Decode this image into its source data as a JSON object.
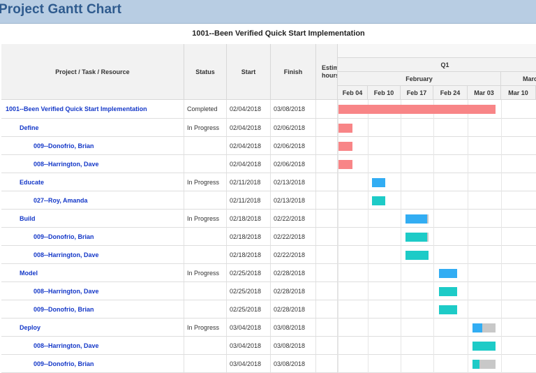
{
  "page_title": "Project Gantt Chart",
  "project_header": "1001--Been Verified Quick Start Implementation",
  "columns": {
    "task": "Project / Task / Resource",
    "status": "Status",
    "start": "Start",
    "finish": "Finish",
    "estimate": "Estimated hours"
  },
  "timeline": {
    "quarter": "Q1",
    "months": [
      "February",
      "March"
    ],
    "weeks": [
      "Feb 04",
      "Feb 10",
      "Feb 17",
      "Feb 24",
      "Mar 03",
      "Mar 10"
    ]
  },
  "colors": {
    "project": "#f88587",
    "task": "#32adf3",
    "resource": "#1dcbc7",
    "remaining": "#c8c8c8"
  },
  "rows": [
    {
      "name": "1001--Been Verified Quick Start Implementation",
      "level": 0,
      "status": "Completed",
      "start": "02/04/2018",
      "finish": "03/08/2018",
      "bar": {
        "start": "2018-02-04",
        "end": "2018-03-08",
        "kind": "project",
        "progress": 1
      }
    },
    {
      "name": "Define",
      "level": 1,
      "status": "In Progress",
      "start": "02/04/2018",
      "finish": "02/06/2018",
      "bar": {
        "start": "2018-02-04",
        "end": "2018-02-06",
        "kind": "project",
        "progress": 1
      }
    },
    {
      "name": "009--Donofrio, Brian",
      "level": 2,
      "status": "",
      "start": "02/04/2018",
      "finish": "02/06/2018",
      "bar": {
        "start": "2018-02-04",
        "end": "2018-02-06",
        "kind": "project",
        "progress": 1
      }
    },
    {
      "name": "008--Harrington, Dave",
      "level": 2,
      "status": "",
      "start": "02/04/2018",
      "finish": "02/06/2018",
      "bar": {
        "start": "2018-02-04",
        "end": "2018-02-06",
        "kind": "project",
        "progress": 1
      }
    },
    {
      "name": "Educate",
      "level": 1,
      "status": "In Progress",
      "start": "02/11/2018",
      "finish": "02/13/2018",
      "bar": {
        "start": "2018-02-11",
        "end": "2018-02-13",
        "kind": "task",
        "progress": 1
      }
    },
    {
      "name": "027--Roy, Amanda",
      "level": 2,
      "status": "",
      "start": "02/11/2018",
      "finish": "02/13/2018",
      "bar": {
        "start": "2018-02-11",
        "end": "2018-02-13",
        "kind": "resource",
        "progress": 1
      }
    },
    {
      "name": "Build",
      "level": 1,
      "status": "In Progress",
      "start": "02/18/2018",
      "finish": "02/22/2018",
      "bar": {
        "start": "2018-02-18",
        "end": "2018-02-22",
        "kind": "task",
        "progress": 0.94
      }
    },
    {
      "name": "009--Donofrio, Brian",
      "level": 2,
      "status": "",
      "start": "02/18/2018",
      "finish": "02/22/2018",
      "bar": {
        "start": "2018-02-18",
        "end": "2018-02-22",
        "kind": "resource",
        "progress": 0.94
      }
    },
    {
      "name": "008--Harrington, Dave",
      "level": 2,
      "status": "",
      "start": "02/18/2018",
      "finish": "02/22/2018",
      "bar": {
        "start": "2018-02-18",
        "end": "2018-02-22",
        "kind": "resource",
        "progress": 1
      }
    },
    {
      "name": "Model",
      "level": 1,
      "status": "In Progress",
      "start": "02/25/2018",
      "finish": "02/28/2018",
      "bar": {
        "start": "2018-02-25",
        "end": "2018-02-28",
        "kind": "task",
        "progress": 1
      }
    },
    {
      "name": "008--Harrington, Dave",
      "level": 2,
      "status": "",
      "start": "02/25/2018",
      "finish": "02/28/2018",
      "bar": {
        "start": "2018-02-25",
        "end": "2018-02-28",
        "kind": "resource",
        "progress": 1
      }
    },
    {
      "name": "009--Donofrio, Brian",
      "level": 2,
      "status": "",
      "start": "02/25/2018",
      "finish": "02/28/2018",
      "bar": {
        "start": "2018-02-25",
        "end": "2018-02-28",
        "kind": "resource",
        "progress": 1
      }
    },
    {
      "name": "Deploy",
      "level": 1,
      "status": "In Progress",
      "start": "03/04/2018",
      "finish": "03/08/2018",
      "bar": {
        "start": "2018-03-04",
        "end": "2018-03-08",
        "kind": "task",
        "progress": 0.42
      }
    },
    {
      "name": "008--Harrington, Dave",
      "level": 2,
      "status": "",
      "start": "03/04/2018",
      "finish": "03/08/2018",
      "bar": {
        "start": "2018-03-04",
        "end": "2018-03-08",
        "kind": "resource",
        "progress": 1
      }
    },
    {
      "name": "009--Donofrio, Brian",
      "level": 2,
      "status": "",
      "start": "03/04/2018",
      "finish": "03/08/2018",
      "bar": {
        "start": "2018-03-04",
        "end": "2018-03-08",
        "kind": "resource",
        "progress": 0.3
      }
    }
  ]
}
